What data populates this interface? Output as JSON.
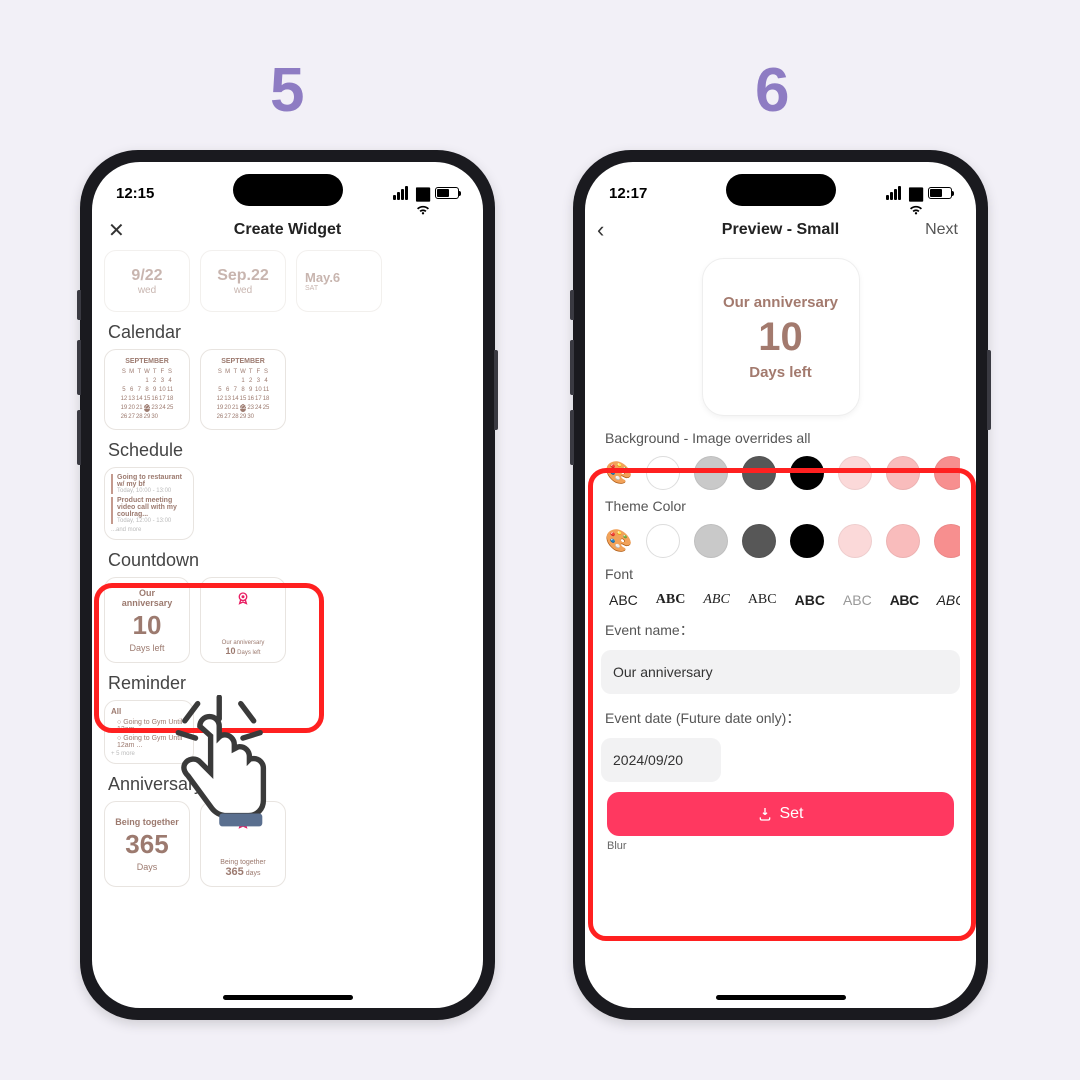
{
  "steps": {
    "five": "5",
    "six": "6"
  },
  "left": {
    "time": "12:15",
    "title": "Create Widget",
    "dateRow": [
      {
        "big": "9/22",
        "sub": "wed"
      },
      {
        "big": "Sep.22",
        "sub": "wed"
      },
      {
        "big": "May.6",
        "sub": "SAT"
      }
    ],
    "sections": {
      "calendar": "Calendar",
      "schedule": "Schedule",
      "countdown": "Countdown",
      "reminder": "Reminder",
      "anniversary": "Anniversary"
    },
    "calMonth": "SEPTEMBER",
    "calDows": [
      "S",
      "M",
      "T",
      "W",
      "T",
      "F",
      "S"
    ],
    "sched": [
      {
        "t": "Going to restaurant w/ my bf",
        "s": "Today, 10:00 - 13:00"
      },
      {
        "t": "Product meeting video call with my coulrag...",
        "s": "Today, 12:00 - 13:00"
      },
      {
        "more": "...and more"
      }
    ],
    "countdown": {
      "title": "Our anniversary",
      "num": "10",
      "sub": "Days left"
    },
    "countdown_small": {
      "title": "Our anniversary",
      "num": "10",
      "sub": "Days left"
    },
    "reminder": {
      "all": "All",
      "items": [
        "Going to Gym Until 12am ...",
        "Going to Gym Until 12am ..."
      ],
      "more": "+ 5 more"
    },
    "anniv": {
      "title": "Being together",
      "num": "365",
      "sub": "Days"
    },
    "anniv_small": {
      "title": "Being together",
      "num": "365",
      "sub": "days"
    }
  },
  "right": {
    "time": "12:17",
    "title": "Preview - Small",
    "next": "Next",
    "preview": {
      "title": "Our anniversary",
      "num": "10",
      "sub": "Days left"
    },
    "labels": {
      "bg": "Background - Image overrides all",
      "theme": "Theme Color",
      "font": "Font",
      "eventName": "Event name：",
      "eventDate": "Event date (Future date only)：",
      "blur": "Blur"
    },
    "fontSample": "ABC",
    "eventNameValue": "Our anniversary",
    "eventDateValue": "2024/09/20",
    "setLabel": "Set",
    "swatches": [
      "#ffffff",
      "#c9c9c9",
      "#575757",
      "#000000",
      "#fbd9d9",
      "#f9bcbc",
      "#f78f8f"
    ]
  }
}
